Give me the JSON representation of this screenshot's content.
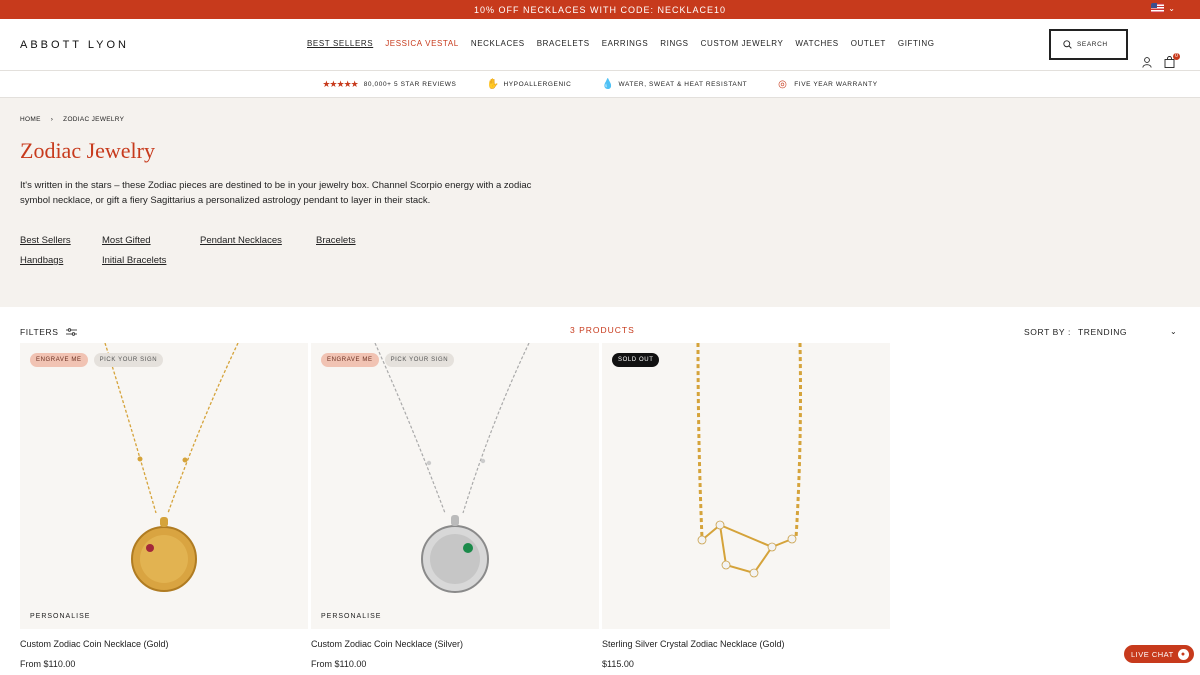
{
  "promo": {
    "text": "10% OFF NECKLACES WITH CODE: NECKLACE10"
  },
  "header": {
    "logo": "ABBOTT LYON",
    "nav": [
      "BEST SELLERS",
      "JESSICA VESTAL",
      "NECKLACES",
      "BRACELETS",
      "EARRINGS",
      "RINGS",
      "CUSTOM JEWELRY",
      "WATCHES",
      "OUTLET",
      "GIFTING"
    ],
    "search_label": "SEARCH",
    "cart_count": "0"
  },
  "trust": {
    "reviews": "80,000+ 5 STAR REVIEWS",
    "hypo": "HYPOALLERGENIC",
    "water": "WATER, SWEAT & HEAT RESISTANT",
    "warranty": "FIVE YEAR WARRANTY"
  },
  "breadcrumb": {
    "home": "HOME",
    "current": "ZODIAC JEWELRY"
  },
  "category": {
    "title": "Zodiac Jewelry",
    "description": "It's written in the stars – these Zodiac pieces are destined to be in your jewelry box. Channel Scorpio energy with a zodiac symbol necklace, or gift a fiery Sagittarius a personalized astrology pendant to layer in their stack.",
    "links": [
      "Best Sellers",
      "Most Gifted",
      "Pendant Necklaces",
      "Bracelets",
      "Handbags",
      "Initial Bracelets"
    ]
  },
  "toolbar": {
    "filters": "FILTERS",
    "count": "3 PRODUCTS",
    "sort_label": "SORT BY :",
    "sort_value": "TRENDING"
  },
  "products": [
    {
      "badges": [
        "ENGRAVE ME",
        "PICK YOUR SIGN"
      ],
      "tag": "PERSONALISE",
      "name": "Custom Zodiac Coin Necklace (Gold)",
      "price": "From $110.00"
    },
    {
      "badges": [
        "ENGRAVE ME",
        "PICK YOUR SIGN"
      ],
      "tag": "PERSONALISE",
      "name": "Custom Zodiac Coin Necklace (Silver)",
      "price": "From $110.00"
    },
    {
      "badges": [
        "SOLD OUT"
      ],
      "tag": "",
      "name": "Sterling Silver Crystal Zodiac Necklace (Gold)",
      "price": "$115.00"
    }
  ],
  "chat": {
    "label": "LIVE CHAT"
  },
  "colors": {
    "accent": "#c73a1c",
    "banner_bg": "#f5f2ee"
  }
}
